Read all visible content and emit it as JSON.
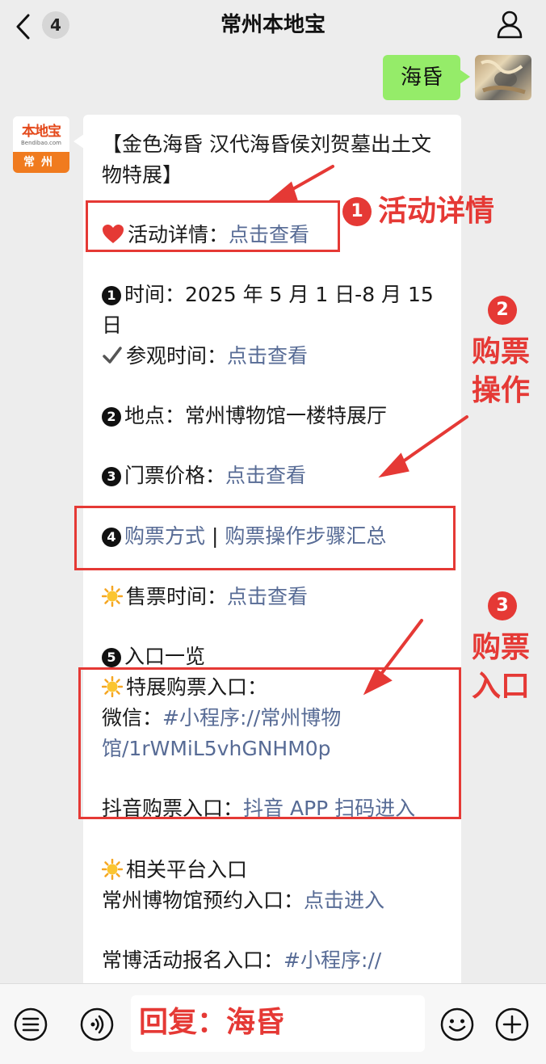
{
  "header": {
    "title": "常州本地宝",
    "back_badge": "4"
  },
  "outgoing": {
    "message": "海昏"
  },
  "bot": {
    "avatar_logo": "本地宝",
    "avatar_site": "Bendibao.com",
    "avatar_city": "常州"
  },
  "article": {
    "title_line1": "【金色海昏 汉代海昏侯刘贺墓出土文",
    "title_line2": "物特展】",
    "detail_label": "活动详情：",
    "detail_link": "点击查看",
    "time_label": "时间：2025 年 5 月 1 日-8 月 15",
    "time_cont": "日",
    "visit_label": "参观时间：",
    "visit_link": "点击查看",
    "place_label": "地点：常州博物馆一楼特展厅",
    "price_label": "门票价格：",
    "price_link": "点击查看",
    "buy_link1": "购票方式",
    "buy_sep": " | ",
    "buy_link2": "购票操作步骤汇总",
    "sale_label": "售票时间：",
    "sale_link": "点击查看",
    "entry_label": "入口一览",
    "special_label": "特展购票入口：",
    "wechat_label": "微信：",
    "wechat_link1": "#小程序://常州博物",
    "wechat_link2": "馆/1rWMiL5vhGNHM0p",
    "douyin_label": "抖音购票入口：",
    "douyin_link": "抖音 APP 扫码进入",
    "platform_label": "相关平台入口",
    "museum_label": "常州博物馆预约入口：",
    "museum_link": "点击进入",
    "activity_label": "常博活动报名入口：",
    "activity_link": "#小程序://"
  },
  "bullets": [
    "1",
    "2",
    "3",
    "4",
    "5"
  ],
  "annotations": {
    "n1": "1",
    "t1": "活动详情",
    "n2": "2",
    "t2a": "购票",
    "t2b": "操作",
    "n3": "3",
    "t3a": "购票",
    "t3b": "入口"
  },
  "input": {
    "reply_text": "回复：海昏"
  },
  "colors": {
    "link": "#576b95",
    "annotation": "#e53935",
    "outgoing_bubble": "#95ec69",
    "background": "#ededed"
  }
}
